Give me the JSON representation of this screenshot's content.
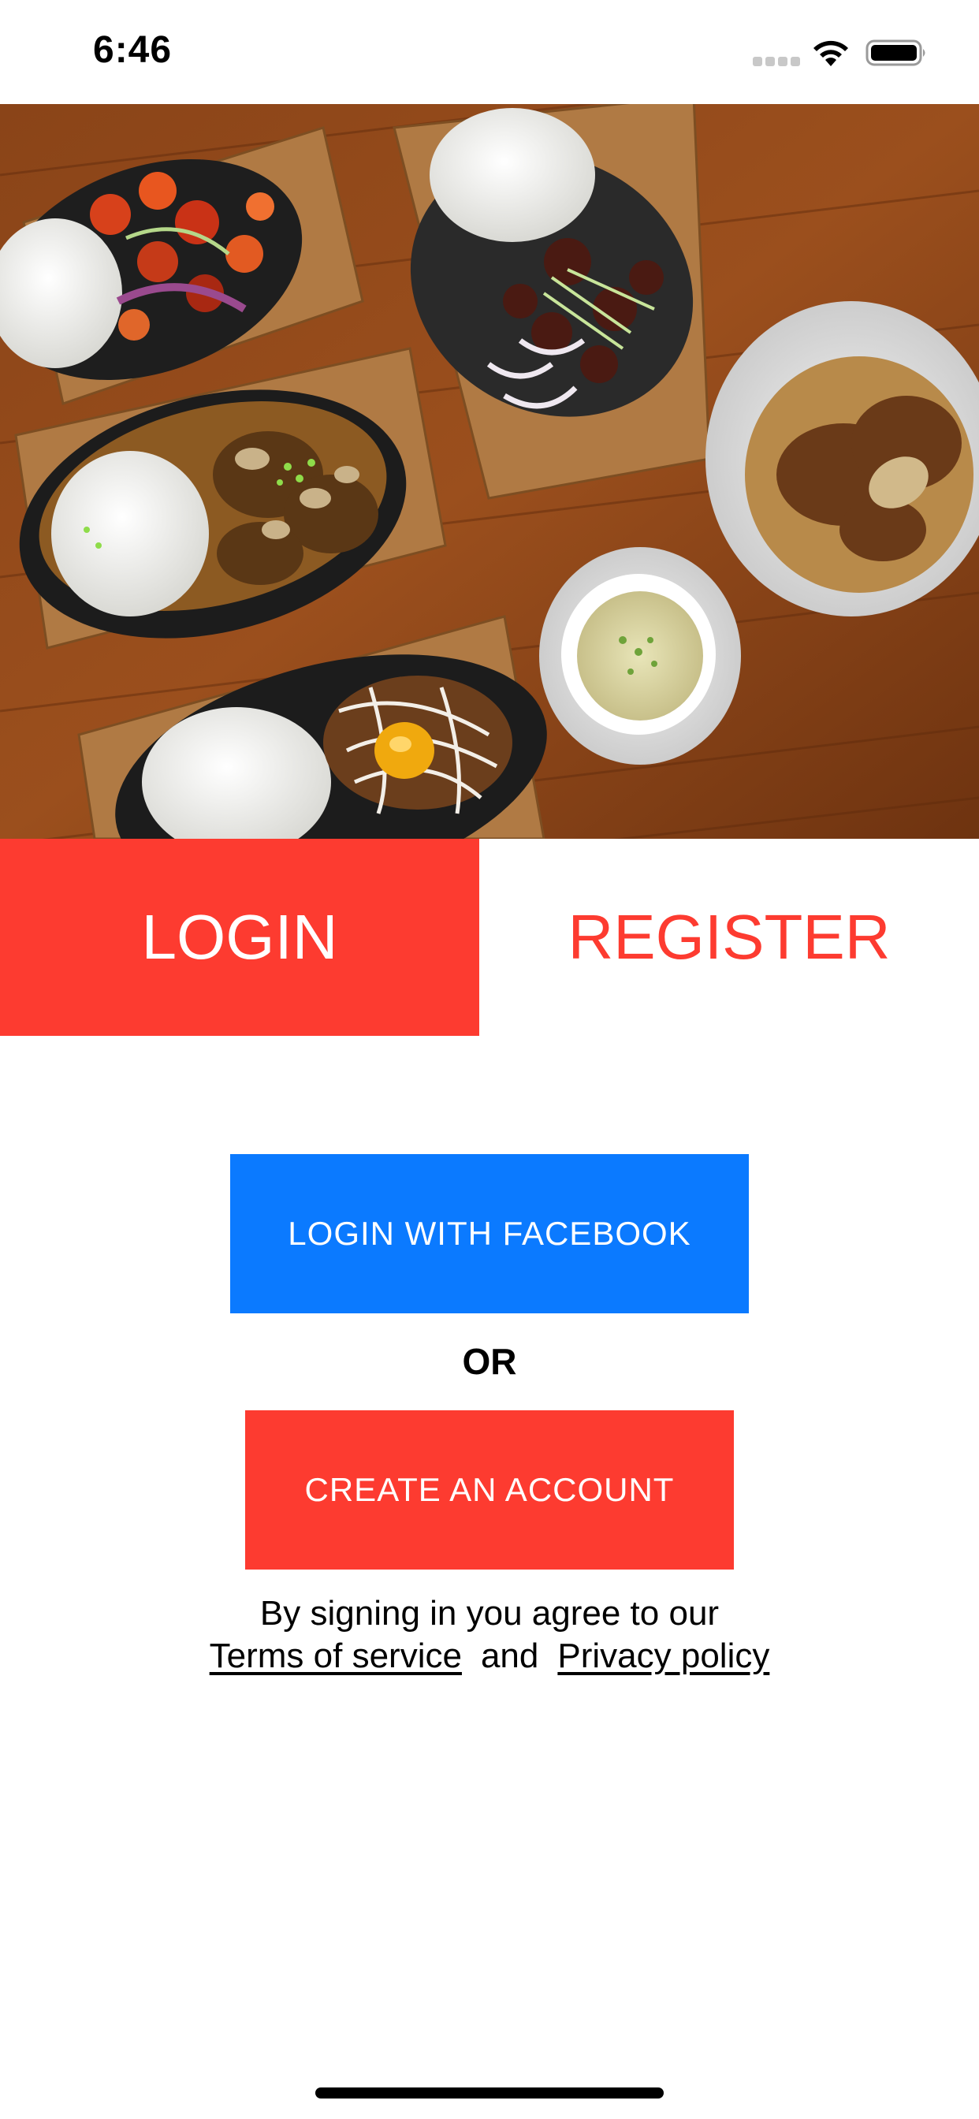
{
  "status_bar": {
    "time": "6:46"
  },
  "hero": {
    "description_icon": "food-photo"
  },
  "tabs": [
    {
      "label": "LOGIN",
      "active": true
    },
    {
      "label": "REGISTER",
      "active": false
    }
  ],
  "buttons": {
    "facebook_label": "LOGIN WITH FACEBOOK",
    "or_label": "OR",
    "create_account_label": "CREATE AN ACCOUNT"
  },
  "terms": {
    "prefix": "By signing in you agree to our",
    "terms_link": "Terms of service",
    "and_text": "and",
    "privacy_link": "Privacy policy"
  },
  "colors": {
    "accent_red": "#fd3b30",
    "facebook_blue": "#0b7aff",
    "background": "#ffffff"
  }
}
